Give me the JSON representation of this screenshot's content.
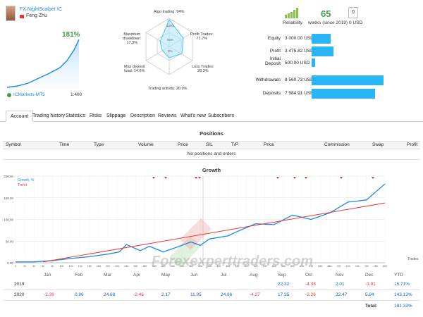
{
  "profile": {
    "signal_name": "FX NightScalper IC",
    "author": "Feng Zhu",
    "growth_pct": "181%",
    "broker": "ICMarkets-MT5",
    "leverage": "1:400"
  },
  "radar": {
    "algo_trading": "Algo trading: 94%",
    "profit_trades": "Profit Trades:\n71.7%",
    "loss_trades": "Loss Trades:\n28.3%",
    "trading_activity": "Trading activity: 20.9%",
    "max_deposit_load": "Max deposit\nload: 14.6%",
    "max_drawdown": "Maximum\ndrawdown:\n17.3%",
    "scale_labels": [
      "100%",
      "50%",
      "0%"
    ]
  },
  "stats": {
    "reliability_label": "Reliability",
    "weeks_value": "65",
    "weeks_label": "weeks (since 2019)",
    "subscribers_value": "0",
    "subscribers_unit": "0 USD",
    "rows": [
      {
        "label": "Equity",
        "value": "3 000.00 USD",
        "fraction": 0.26
      },
      {
        "label": "Profit",
        "value": "3 475.82 USD",
        "fraction": 0.3
      },
      {
        "label": "Initial\nDeposit",
        "value": "500.00 USD",
        "fraction": 0.05
      },
      {
        "label": "Withdrawals",
        "value": "8 560.73 USD",
        "fraction": 1.0
      },
      {
        "label": "Deposits",
        "value": "7 584.91 USD",
        "fraction": 0.88
      }
    ]
  },
  "tabs": [
    "Account",
    "Trading history",
    "Statistics",
    "Risks",
    "Slippage",
    "Description",
    "Reviews",
    "What's new",
    "Subscribers"
  ],
  "positions": {
    "title": "Positions",
    "columns": [
      "Symbol",
      "Time",
      "Type",
      "Volume",
      "Price",
      "S/L",
      "T/P",
      "Price",
      "Commission",
      "Swap",
      "Profit"
    ],
    "empty_text": "No positions and orders"
  },
  "growth": {
    "title": "Growth",
    "legend_growth": "Growth, %",
    "legend_trend": "Trend",
    "trades_label": "Trades",
    "watermark": "Forexexperttraders.com"
  },
  "chart_data": {
    "type": "line",
    "y_ticks": [
      "200.00",
      "150.00",
      "100.00",
      "50.00",
      "0.00"
    ],
    "ylim": [
      0,
      200
    ],
    "x_ticks": [
      "0",
      "20",
      "40",
      "60",
      "80",
      "100",
      "120",
      "140",
      "160",
      "180",
      "200",
      "220",
      "240",
      "260",
      "280",
      "300",
      "320",
      "340",
      "360",
      "380",
      "400",
      "420",
      "440",
      "460",
      "480",
      "500",
      "520",
      "540",
      "560",
      "580",
      "600",
      "620",
      "640",
      "660",
      "680",
      "700",
      "720",
      "740",
      "760",
      "780",
      "800"
    ],
    "months": [
      "Jan",
      "Feb",
      "Mar",
      "Apr",
      "May",
      "Jun",
      "Jul",
      "Aug",
      "Sep",
      "Oct",
      "Nov",
      "Dec",
      "YTD"
    ],
    "series": [
      {
        "name": "Growth, %",
        "color": "#1e88e5",
        "x": [
          0,
          40,
          80,
          120,
          160,
          200,
          225,
          240,
          270,
          290,
          320,
          360,
          380,
          400,
          420,
          460,
          480,
          520,
          560,
          600,
          640,
          680,
          720,
          760,
          800
        ],
        "y": [
          2,
          2,
          5,
          10,
          14,
          20,
          25,
          42,
          28,
          38,
          25,
          40,
          48,
          40,
          55,
          62,
          72,
          90,
          88,
          110,
          100,
          115,
          140,
          145,
          182
        ]
      },
      {
        "name": "Trend",
        "color": "#e53935",
        "x": [
          60,
          800
        ],
        "y": [
          2,
          138
        ]
      }
    ]
  },
  "yearly": {
    "rows": [
      {
        "year": "2019",
        "values": [
          "",
          "",
          "",
          "",
          "",
          "",
          "",
          "",
          "22.32",
          "-4.38",
          "2.01",
          "-3.01",
          "15.71%"
        ]
      },
      {
        "year": "2020",
        "values": [
          "-2.39",
          "0.86",
          "24.68",
          "-2.46",
          "2.17",
          "11.95",
          "24.86",
          "-4.27",
          "17.25",
          "-2.26",
          "22.47",
          "5.84",
          "143.13%"
        ]
      }
    ],
    "total_label": "Total:",
    "total_value": "181.33%"
  },
  "colors": {
    "accent": "#1e88e5",
    "bar": "#29b6f6",
    "negative": "#e53935",
    "positive": "#1565c0"
  }
}
